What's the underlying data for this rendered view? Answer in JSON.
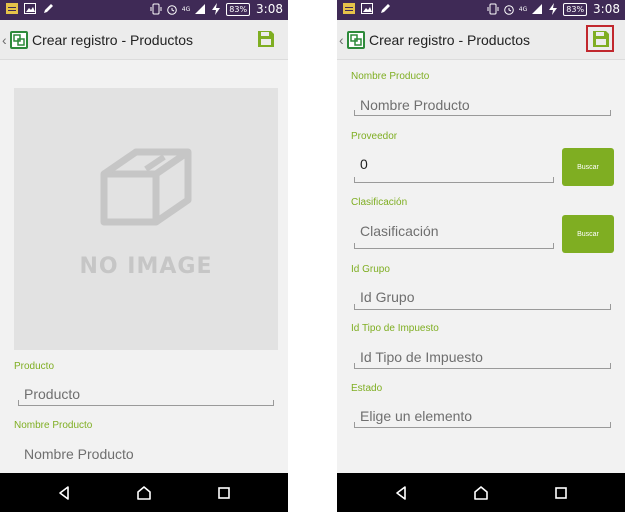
{
  "status_bar": {
    "network": "4G",
    "battery": "83%",
    "time": "3:08"
  },
  "left_screen": {
    "action_bar": {
      "title": "Crear registro - Productos"
    },
    "image_placeholder": {
      "text": "NO IMAGE"
    },
    "fields": [
      {
        "label": "Producto",
        "hint": "Producto"
      },
      {
        "label": "Nombre Producto",
        "hint": "Nombre Producto"
      }
    ]
  },
  "right_screen": {
    "action_bar": {
      "title": "Crear registro - Productos"
    },
    "fields": [
      {
        "label": "Nombre Producto",
        "hint": "Nombre Producto"
      },
      {
        "label": "Proveedor",
        "value": "0",
        "button": "Buscar"
      },
      {
        "label": "Clasificación",
        "hint": "Clasificación",
        "button": "Buscar"
      },
      {
        "label": "Id Grupo",
        "hint": "Id Grupo"
      },
      {
        "label": "Id Tipo de Impuesto",
        "hint": "Id Tipo de Impuesto"
      },
      {
        "label": "Estado",
        "hint": "Elige un elemento"
      }
    ]
  },
  "colors": {
    "status_bar": "#3f2a56",
    "accent_green": "#7fae22",
    "highlight_red": "#c1272d",
    "nav_bar": "#000000"
  },
  "icons": [
    "back-arrow-icon",
    "app-icon",
    "save-icon",
    "box-icon",
    "nav-back-icon",
    "nav-home-icon",
    "nav-recents-icon"
  ]
}
